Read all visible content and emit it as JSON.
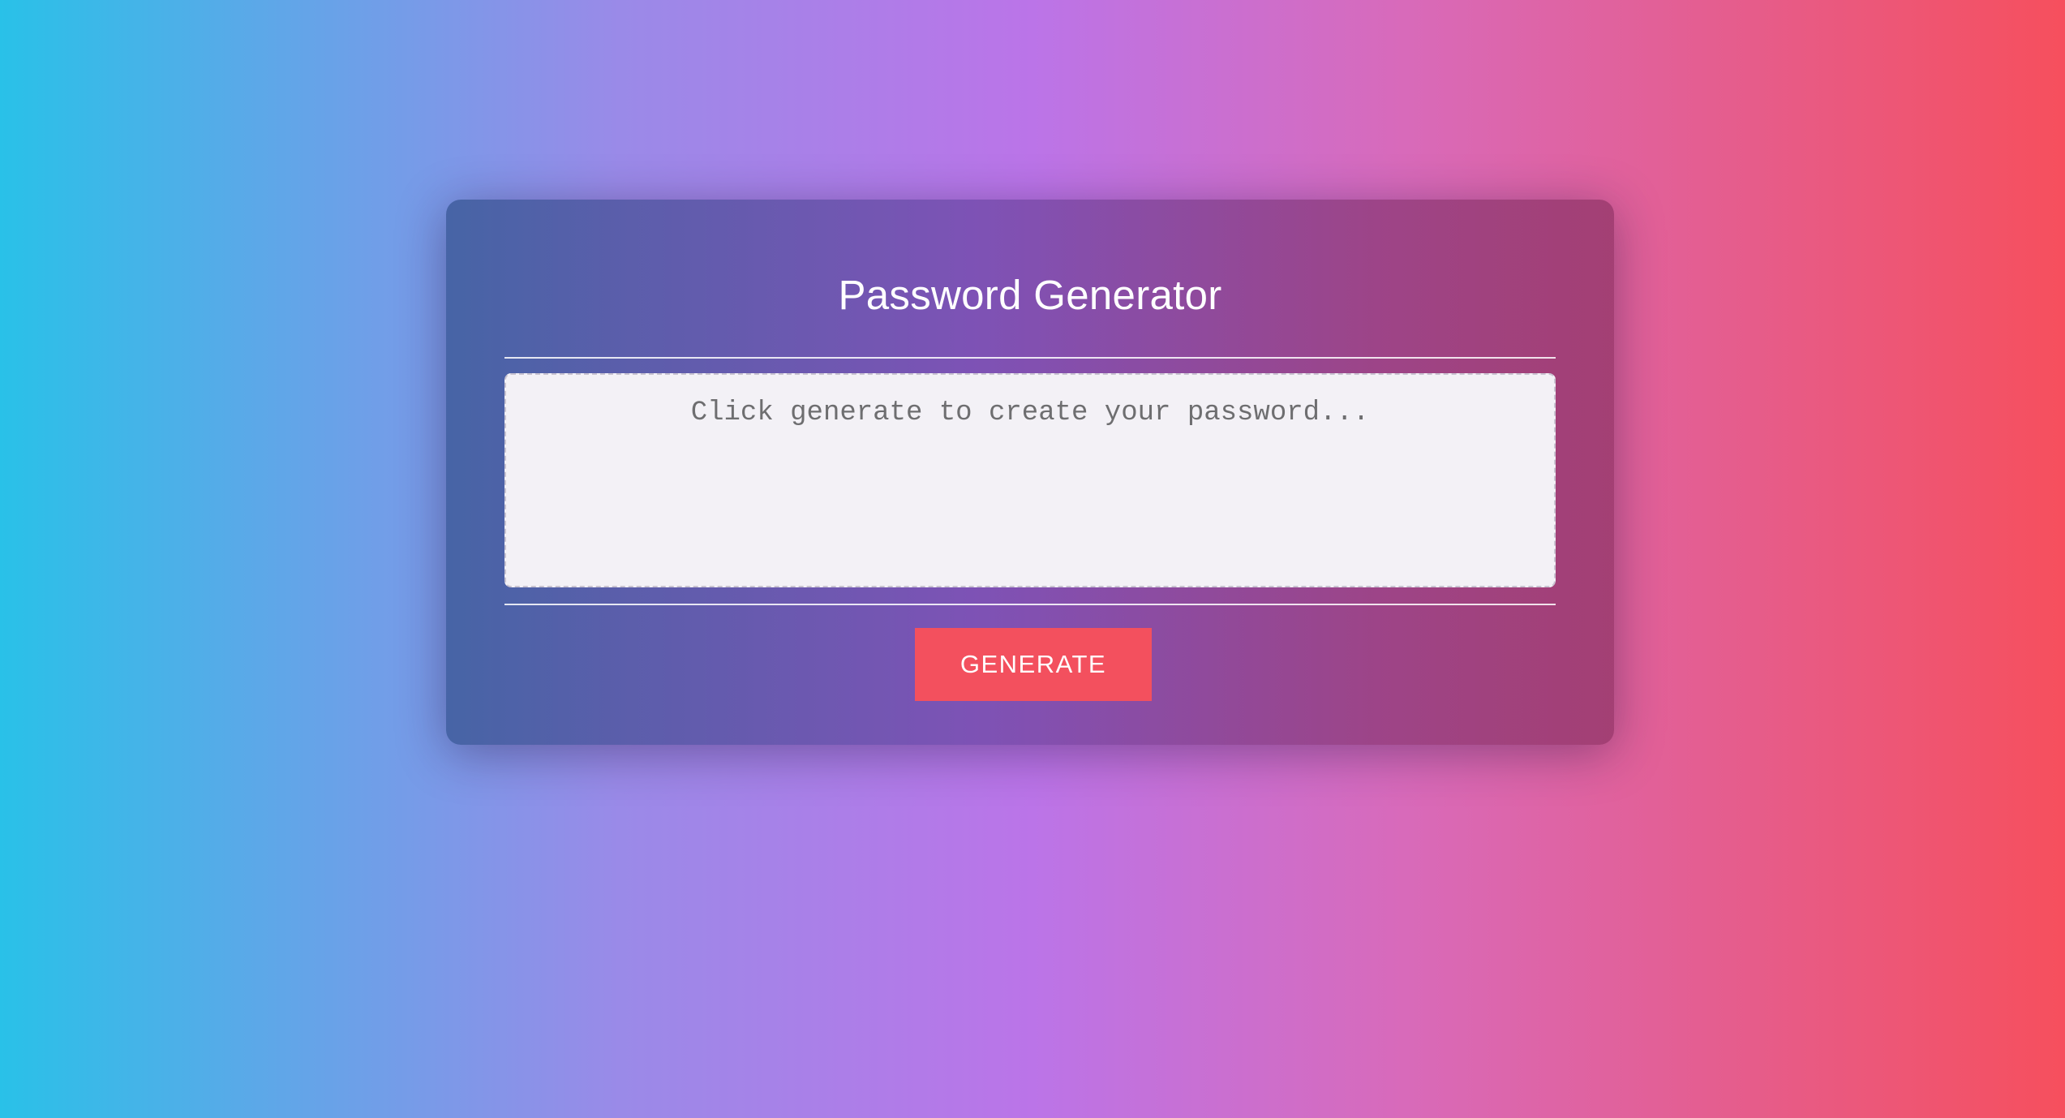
{
  "card": {
    "title": "Password Generator"
  },
  "password_field": {
    "value": "",
    "placeholder": "Click generate to create your password..."
  },
  "generate_button": {
    "label": "GENERATE"
  },
  "colors": {
    "button": "#f3505e",
    "gradient_left": "#29c1e8",
    "gradient_middle": "#bb74e8",
    "gradient_right": "#f64f5d"
  }
}
